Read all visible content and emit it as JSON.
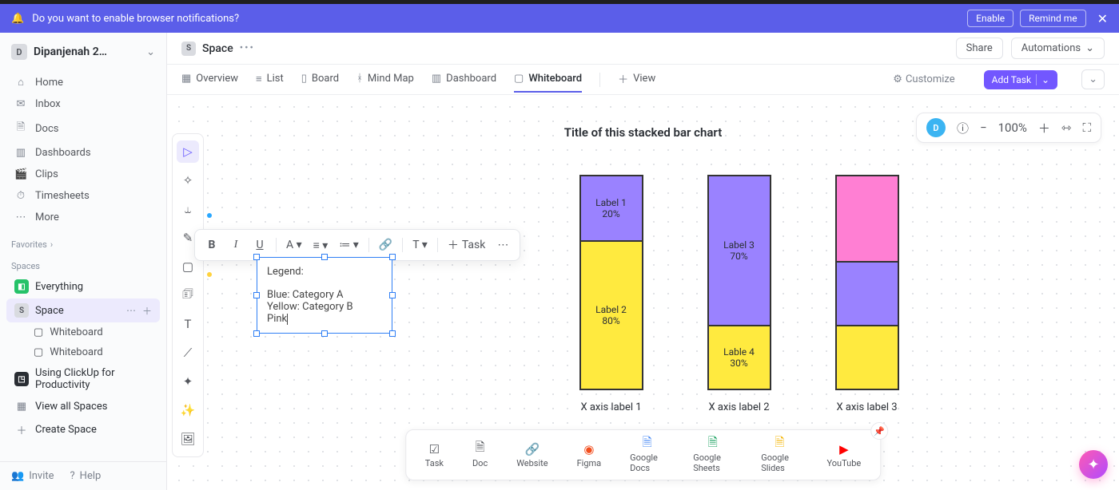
{
  "banner": {
    "text": "Do you want to enable browser notifications?",
    "enable": "Enable",
    "remind": "Remind me"
  },
  "workspace": {
    "initial": "D",
    "name": "Dipanjenah 2…"
  },
  "nav": {
    "home": "Home",
    "inbox": "Inbox",
    "docs": "Docs",
    "dashboards": "Dashboards",
    "clips": "Clips",
    "timesheets": "Timesheets",
    "more": "More"
  },
  "sections": {
    "favorites": "Favorites",
    "spaces": "Spaces"
  },
  "spaces": {
    "everything": "Everything",
    "space": "Space",
    "whiteboard1": "Whiteboard",
    "whiteboard2": "Whiteboard",
    "using": "Using ClickUp for Productivity",
    "viewall": "View all Spaces",
    "create": "Create Space"
  },
  "footer": {
    "invite": "Invite",
    "help": "Help"
  },
  "crumb": {
    "badge": "S",
    "title": "Space"
  },
  "crumb_actions": {
    "share": "Share",
    "automations": "Automations"
  },
  "tabs": {
    "overview": "Overview",
    "list": "List",
    "board": "Board",
    "mindmap": "Mind Map",
    "dashboard": "Dashboard",
    "whiteboard": "Whiteboard",
    "view": "View",
    "customize": "Customize",
    "addtask": "Add Task"
  },
  "canvas": {
    "avatar": "D",
    "zoom": "100%",
    "chart_title": "Title of this stacked bar chart",
    "x1": "X axis label 1",
    "x2": "X axis label 2",
    "x3": "X axis label 3"
  },
  "segs": {
    "b1s1l": "Label 1",
    "b1s1p": "20%",
    "b1s2l": "Label 2",
    "b1s2p": "80%",
    "b2s1l": "Label 3",
    "b2s1p": "70%",
    "b2s2l": "Lable 4",
    "b2s2p": "30%"
  },
  "legend": {
    "title": "Legend:",
    "l1": "Blue: Category A",
    "l2": "Yellow: Category B",
    "l3": "Pink"
  },
  "toolbar_task": "Task",
  "dock": {
    "task": "Task",
    "doc": "Doc",
    "website": "Website",
    "figma": "Figma",
    "gdocs": "Google Docs",
    "gsheets": "Google Sheets",
    "gslides": "Google Slides",
    "youtube": "YouTube"
  },
  "chart_data": {
    "type": "bar",
    "stacked": true,
    "categories": [
      "X axis label 1",
      "X axis label 2",
      "X axis label 3"
    ],
    "series": [
      {
        "name": "Category A (Blue/Purple)",
        "values": [
          20,
          70,
          30
        ]
      },
      {
        "name": "Category B (Yellow)",
        "values": [
          80,
          30,
          30
        ]
      },
      {
        "name": "Pink",
        "values": [
          0,
          0,
          40
        ]
      }
    ],
    "labels": [
      [
        {
          "text": "Label 1",
          "pct": "20%"
        },
        {
          "text": "Label 2",
          "pct": "80%"
        }
      ],
      [
        {
          "text": "Label 3",
          "pct": "70%"
        },
        {
          "text": "Lable 4",
          "pct": "30%"
        }
      ],
      []
    ],
    "title": "Title of this stacked bar chart",
    "legend": [
      "Blue: Category A",
      "Yellow: Category B",
      "Pink"
    ]
  }
}
